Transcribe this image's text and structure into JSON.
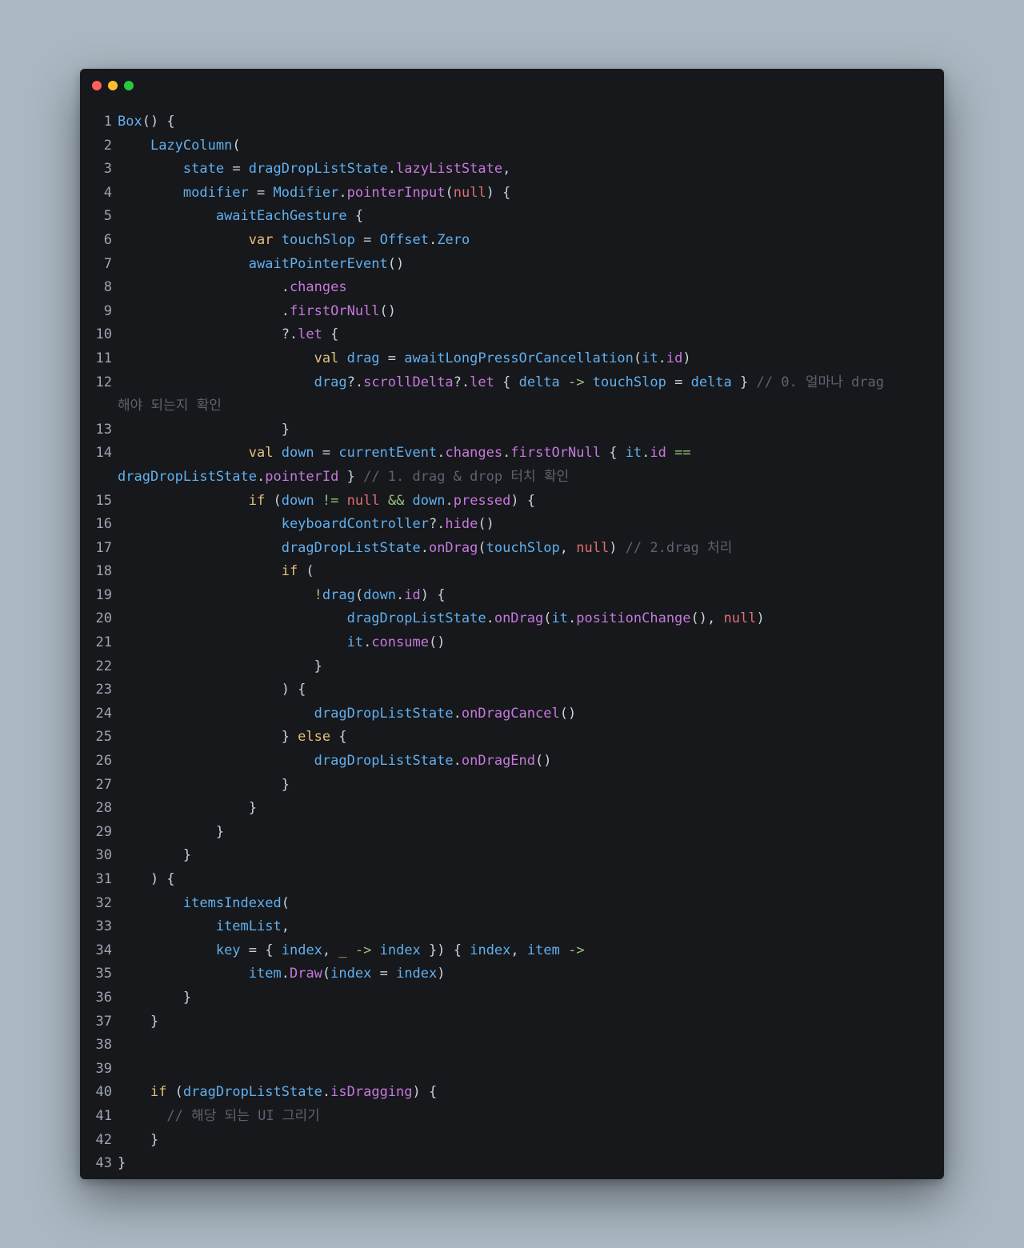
{
  "window": {
    "controls": [
      {
        "name": "close-button",
        "color": "#ff5f56"
      },
      {
        "name": "minimize-button",
        "color": "#ffbd2e"
      },
      {
        "name": "zoom-button",
        "color": "#27c93f"
      }
    ]
  },
  "palette": {
    "d": "#c9d1d9",
    "fn": "#61afef",
    "m": "#c678dd",
    "k": "#e5c07b",
    "n": "#e06c75",
    "op": "#98c379",
    "c": "#5c6370",
    "ln": "#9da5b4"
  },
  "editor": {
    "lines": [
      {
        "num": "1",
        "segments": [
          [
            "fn",
            "Box"
          ],
          [
            "d",
            "() {"
          ]
        ]
      },
      {
        "num": "2",
        "segments": [
          [
            "d",
            "    "
          ],
          [
            "fn",
            "LazyColumn"
          ],
          [
            "d",
            "("
          ]
        ]
      },
      {
        "num": "3",
        "segments": [
          [
            "d",
            "        "
          ],
          [
            "fn",
            "state"
          ],
          [
            "d",
            " = "
          ],
          [
            "fn",
            "dragDropListState"
          ],
          [
            "d",
            "."
          ],
          [
            "m",
            "lazyListState"
          ],
          [
            "d",
            ","
          ]
        ]
      },
      {
        "num": "4",
        "segments": [
          [
            "d",
            "        "
          ],
          [
            "fn",
            "modifier"
          ],
          [
            "d",
            " = "
          ],
          [
            "fn",
            "Modifier"
          ],
          [
            "d",
            "."
          ],
          [
            "m",
            "pointerInput"
          ],
          [
            "d",
            "("
          ],
          [
            "n",
            "null"
          ],
          [
            "d",
            ") {"
          ]
        ]
      },
      {
        "num": "5",
        "segments": [
          [
            "d",
            "            "
          ],
          [
            "fn",
            "awaitEachGesture"
          ],
          [
            "d",
            " {"
          ]
        ]
      },
      {
        "num": "6",
        "segments": [
          [
            "d",
            "                "
          ],
          [
            "k",
            "var "
          ],
          [
            "fn",
            "touchSlop"
          ],
          [
            "d",
            " = "
          ],
          [
            "fn",
            "Offset"
          ],
          [
            "d",
            "."
          ],
          [
            "fn",
            "Zero"
          ]
        ]
      },
      {
        "num": "7",
        "segments": [
          [
            "d",
            "                "
          ],
          [
            "fn",
            "awaitPointerEvent"
          ],
          [
            "d",
            "()"
          ]
        ]
      },
      {
        "num": "8",
        "segments": [
          [
            "d",
            "                    ."
          ],
          [
            "m",
            "changes"
          ]
        ]
      },
      {
        "num": "9",
        "segments": [
          [
            "d",
            "                    ."
          ],
          [
            "m",
            "firstOrNull"
          ],
          [
            "d",
            "()"
          ]
        ]
      },
      {
        "num": "10",
        "segments": [
          [
            "d",
            "                    ?."
          ],
          [
            "m",
            "let"
          ],
          [
            "d",
            " {"
          ]
        ]
      },
      {
        "num": "11",
        "segments": [
          [
            "d",
            "                        "
          ],
          [
            "k",
            "val "
          ],
          [
            "fn",
            "drag"
          ],
          [
            "d",
            " = "
          ],
          [
            "fn",
            "awaitLongPressOrCancellation"
          ],
          [
            "d",
            "("
          ],
          [
            "fn",
            "it"
          ],
          [
            "d",
            "."
          ],
          [
            "m",
            "id"
          ],
          [
            "d",
            ")"
          ]
        ]
      },
      {
        "num": "12",
        "segments": [
          [
            "d",
            "                        "
          ],
          [
            "fn",
            "drag"
          ],
          [
            "d",
            "?."
          ],
          [
            "m",
            "scrollDelta"
          ],
          [
            "d",
            "?."
          ],
          [
            "m",
            "let"
          ],
          [
            "d",
            " { "
          ],
          [
            "fn",
            "delta"
          ],
          [
            "op",
            " -> "
          ],
          [
            "fn",
            "touchSlop"
          ],
          [
            "d",
            " = "
          ],
          [
            "fn",
            "delta"
          ],
          [
            "d",
            " } "
          ],
          [
            "c",
            "// 0. 얼마나 drag"
          ]
        ]
      },
      {
        "num": "",
        "segments": [
          [
            "c",
            "해야 되는지 확인"
          ]
        ]
      },
      {
        "num": "13",
        "segments": [
          [
            "d",
            "                    }"
          ]
        ]
      },
      {
        "num": "14",
        "segments": [
          [
            "d",
            "                "
          ],
          [
            "k",
            "val "
          ],
          [
            "fn",
            "down"
          ],
          [
            "d",
            " = "
          ],
          [
            "fn",
            "currentEvent"
          ],
          [
            "d",
            "."
          ],
          [
            "m",
            "changes"
          ],
          [
            "d",
            "."
          ],
          [
            "m",
            "firstOrNull"
          ],
          [
            "d",
            " { "
          ],
          [
            "fn",
            "it"
          ],
          [
            "d",
            "."
          ],
          [
            "m",
            "id"
          ],
          [
            "op",
            " =="
          ]
        ]
      },
      {
        "num": "",
        "segments": [
          [
            "fn",
            "dragDropListState"
          ],
          [
            "d",
            "."
          ],
          [
            "m",
            "pointerId"
          ],
          [
            "d",
            " } "
          ],
          [
            "c",
            "// 1. drag & drop 터치 확인"
          ]
        ]
      },
      {
        "num": "15",
        "segments": [
          [
            "d",
            "                "
          ],
          [
            "k",
            "if"
          ],
          [
            "d",
            " ("
          ],
          [
            "fn",
            "down"
          ],
          [
            "op",
            " != "
          ],
          [
            "n",
            "null"
          ],
          [
            "op",
            " && "
          ],
          [
            "fn",
            "down"
          ],
          [
            "d",
            "."
          ],
          [
            "m",
            "pressed"
          ],
          [
            "d",
            ") {"
          ]
        ]
      },
      {
        "num": "16",
        "segments": [
          [
            "d",
            "                    "
          ],
          [
            "fn",
            "keyboardController"
          ],
          [
            "d",
            "?."
          ],
          [
            "m",
            "hide"
          ],
          [
            "d",
            "()"
          ]
        ]
      },
      {
        "num": "17",
        "segments": [
          [
            "d",
            "                    "
          ],
          [
            "fn",
            "dragDropListState"
          ],
          [
            "d",
            "."
          ],
          [
            "m",
            "onDrag"
          ],
          [
            "d",
            "("
          ],
          [
            "fn",
            "touchSlop"
          ],
          [
            "d",
            ", "
          ],
          [
            "n",
            "null"
          ],
          [
            "d",
            ") "
          ],
          [
            "c",
            "// 2.drag 처리"
          ]
        ]
      },
      {
        "num": "18",
        "segments": [
          [
            "d",
            "                    "
          ],
          [
            "k",
            "if"
          ],
          [
            "d",
            " ("
          ]
        ]
      },
      {
        "num": "19",
        "segments": [
          [
            "d",
            "                        "
          ],
          [
            "op",
            "!"
          ],
          [
            "fn",
            "drag"
          ],
          [
            "d",
            "("
          ],
          [
            "fn",
            "down"
          ],
          [
            "d",
            "."
          ],
          [
            "m",
            "id"
          ],
          [
            "d",
            ") {"
          ]
        ]
      },
      {
        "num": "20",
        "segments": [
          [
            "d",
            "                            "
          ],
          [
            "fn",
            "dragDropListState"
          ],
          [
            "d",
            "."
          ],
          [
            "m",
            "onDrag"
          ],
          [
            "d",
            "("
          ],
          [
            "fn",
            "it"
          ],
          [
            "d",
            "."
          ],
          [
            "m",
            "positionChange"
          ],
          [
            "d",
            "(), "
          ],
          [
            "n",
            "null"
          ],
          [
            "d",
            ")"
          ]
        ]
      },
      {
        "num": "21",
        "segments": [
          [
            "d",
            "                            "
          ],
          [
            "fn",
            "it"
          ],
          [
            "d",
            "."
          ],
          [
            "m",
            "consume"
          ],
          [
            "d",
            "()"
          ]
        ]
      },
      {
        "num": "22",
        "segments": [
          [
            "d",
            "                        }"
          ]
        ]
      },
      {
        "num": "23",
        "segments": [
          [
            "d",
            "                    ) {"
          ]
        ]
      },
      {
        "num": "24",
        "segments": [
          [
            "d",
            "                        "
          ],
          [
            "fn",
            "dragDropListState"
          ],
          [
            "d",
            "."
          ],
          [
            "m",
            "onDragCancel"
          ],
          [
            "d",
            "()"
          ]
        ]
      },
      {
        "num": "25",
        "segments": [
          [
            "d",
            "                    } "
          ],
          [
            "k",
            "else"
          ],
          [
            "d",
            " {"
          ]
        ]
      },
      {
        "num": "26",
        "segments": [
          [
            "d",
            "                        "
          ],
          [
            "fn",
            "dragDropListState"
          ],
          [
            "d",
            "."
          ],
          [
            "m",
            "onDragEnd"
          ],
          [
            "d",
            "()"
          ]
        ]
      },
      {
        "num": "27",
        "segments": [
          [
            "d",
            "                    }"
          ]
        ]
      },
      {
        "num": "28",
        "segments": [
          [
            "d",
            "                }"
          ]
        ]
      },
      {
        "num": "29",
        "segments": [
          [
            "d",
            "            }"
          ]
        ]
      },
      {
        "num": "30",
        "segments": [
          [
            "d",
            "        }"
          ]
        ]
      },
      {
        "num": "31",
        "segments": [
          [
            "d",
            "    ) {"
          ]
        ]
      },
      {
        "num": "32",
        "segments": [
          [
            "d",
            "        "
          ],
          [
            "fn",
            "itemsIndexed"
          ],
          [
            "d",
            "("
          ]
        ]
      },
      {
        "num": "33",
        "segments": [
          [
            "d",
            "            "
          ],
          [
            "fn",
            "itemList"
          ],
          [
            "d",
            ","
          ]
        ]
      },
      {
        "num": "34",
        "segments": [
          [
            "d",
            "            "
          ],
          [
            "fn",
            "key"
          ],
          [
            "d",
            " = { "
          ],
          [
            "fn",
            "index"
          ],
          [
            "d",
            ", "
          ],
          [
            "k",
            "_"
          ],
          [
            "op",
            " -> "
          ],
          [
            "fn",
            "index"
          ],
          [
            "d",
            " }) { "
          ],
          [
            "fn",
            "index"
          ],
          [
            "d",
            ", "
          ],
          [
            "fn",
            "item"
          ],
          [
            "op",
            " ->"
          ]
        ]
      },
      {
        "num": "35",
        "segments": [
          [
            "d",
            "                "
          ],
          [
            "fn",
            "item"
          ],
          [
            "d",
            "."
          ],
          [
            "m",
            "Draw"
          ],
          [
            "d",
            "("
          ],
          [
            "fn",
            "index"
          ],
          [
            "d",
            " = "
          ],
          [
            "fn",
            "index"
          ],
          [
            "d",
            ")"
          ]
        ]
      },
      {
        "num": "36",
        "segments": [
          [
            "d",
            "        }"
          ]
        ]
      },
      {
        "num": "37",
        "segments": [
          [
            "d",
            "    }"
          ]
        ]
      },
      {
        "num": "38",
        "segments": []
      },
      {
        "num": "39",
        "segments": []
      },
      {
        "num": "40",
        "segments": [
          [
            "d",
            "    "
          ],
          [
            "k",
            "if"
          ],
          [
            "d",
            " ("
          ],
          [
            "fn",
            "dragDropListState"
          ],
          [
            "d",
            "."
          ],
          [
            "m",
            "isDragging"
          ],
          [
            "d",
            ") {"
          ]
        ]
      },
      {
        "num": "41",
        "segments": [
          [
            "d",
            "      "
          ],
          [
            "c",
            "// 해당 되는 UI 그리기"
          ]
        ]
      },
      {
        "num": "42",
        "segments": [
          [
            "d",
            "    }"
          ]
        ]
      },
      {
        "num": "43",
        "segments": [
          [
            "d",
            "}"
          ]
        ]
      }
    ]
  }
}
